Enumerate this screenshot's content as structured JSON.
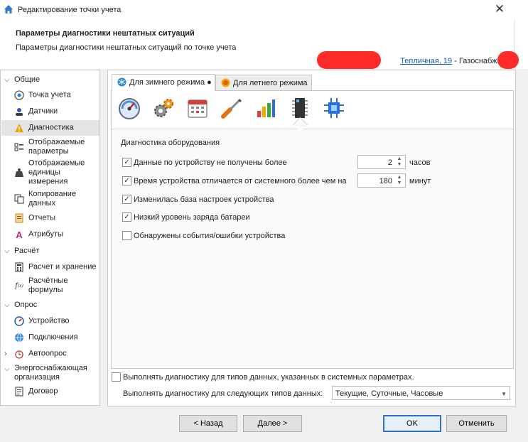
{
  "window": {
    "title": "Редактирование точки учета"
  },
  "header": {
    "title": "Параметры диагностики нештатных ситуаций",
    "subtitle": "Параметры диагностики нештатных ситуаций по точке учета",
    "address_link": "Тепличная, 19",
    "address_rest": " - Газоснабжение"
  },
  "nav": {
    "groups": [
      "Общие",
      "Расчёт",
      "Опрос",
      "Энергоснабжающая организация"
    ],
    "items": [
      "Точка учета",
      "Датчики",
      "Диагностика",
      "Отображаемые параметры",
      "Отображаемые единицы измерения",
      "Копирование данных",
      "Отчеты",
      "Атрибуты",
      "Расчет и хранение",
      "Расчётные формулы",
      "Устройство",
      "Подключения",
      "Автоопрос",
      "Договор"
    ],
    "selected": "Диагностика"
  },
  "tabs": [
    {
      "label": "Для зимнего режима ●"
    },
    {
      "label": "Для летнего режима"
    }
  ],
  "toolbar_icons": [
    "gauge-icon",
    "gears-icon",
    "calendar-icon",
    "screwdriver-icon",
    "bar-chart-icon",
    "chip-icon",
    "processor-icon"
  ],
  "section_title": "Диагностика оборудования",
  "checks": [
    {
      "label": "Данные по устройству не получены более",
      "checked": true,
      "value": "2",
      "unit": "часов"
    },
    {
      "label": "Время устройства отличается от системного более чем на",
      "checked": true,
      "value": "180",
      "unit": "минут"
    },
    {
      "label": "Изменилась база настроек устройства",
      "checked": true
    },
    {
      "label": "Низкий уровень заряда батареи",
      "checked": true
    },
    {
      "label": "Обнаружены события/ошибки устройства",
      "checked": false
    }
  ],
  "bottom": {
    "sys_check_label": "Выполнять диагностику для типов данных, указанных в системных параметрах.",
    "types_label": "Выполнять диагностику для следующих типов данных:",
    "types_value": "Текущие, Суточные, Часовые"
  },
  "buttons": {
    "back": "< Назад",
    "next": "Далее >",
    "ok": "OK",
    "cancel": "Отменить"
  },
  "colors": {
    "accent": "#2f6fcf",
    "link": "#1a5fb4",
    "redaction": "#ff2b2b"
  }
}
